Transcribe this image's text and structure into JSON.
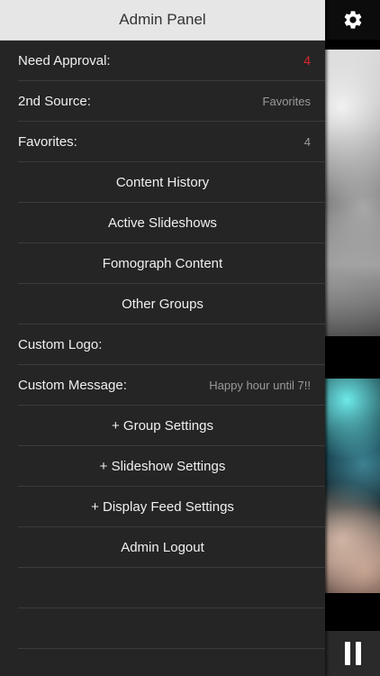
{
  "header": {
    "title": "Admin Panel"
  },
  "menu": {
    "need_approval": {
      "label": "Need Approval:",
      "value": "4"
    },
    "second_source": {
      "label": "2nd Source:",
      "value": "Favorites"
    },
    "favorites": {
      "label": "Favorites:",
      "value": "4"
    },
    "content_history": "Content History",
    "active_slideshows": "Active Slideshows",
    "fomograph_content": "Fomograph Content",
    "other_groups": "Other Groups",
    "custom_logo": {
      "label": "Custom Logo:"
    },
    "custom_message": {
      "label": "Custom Message:",
      "value": "Happy hour until 7!!"
    },
    "group_settings": "+ Group Settings",
    "slideshow_settings": "+ Slideshow Settings",
    "display_feed_settings": "+ Display Feed Settings",
    "admin_logout": "Admin Logout"
  },
  "strip": {
    "settings_icon": "gear-icon",
    "pause_icon": "pause-icon"
  },
  "colors": {
    "panel_bg": "#252525",
    "header_bg": "#e6e6e6",
    "alert": "#d9282b",
    "muted_value": "#9a9a9a"
  }
}
